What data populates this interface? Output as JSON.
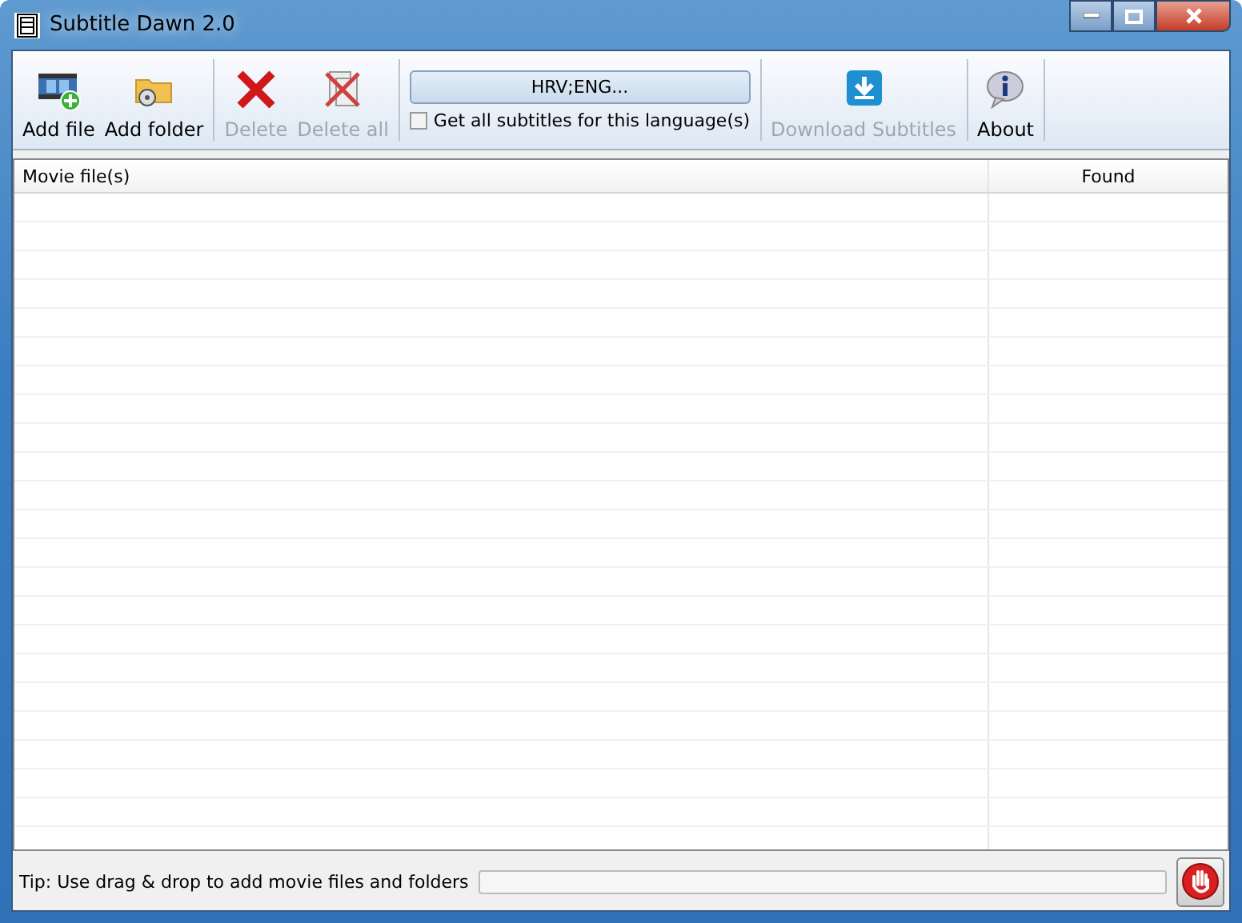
{
  "window": {
    "title": "Subtitle Dawn 2.0"
  },
  "toolbar": {
    "groups": [
      [
        {
          "label": "Add file",
          "disabled": false
        },
        {
          "label": "Add folder",
          "disabled": false
        }
      ],
      [
        {
          "label": "Delete",
          "disabled": true
        },
        {
          "label": "Delete all",
          "disabled": true
        }
      ],
      [
        {
          "kind": "language",
          "label": "HRV;ENG...",
          "checkbox": {
            "label": "Get all subtitles for this language(s)",
            "checked": false
          }
        }
      ],
      [
        {
          "label": "Download Subtitles",
          "disabled": true
        }
      ],
      [
        {
          "label": "About",
          "disabled": false
        }
      ]
    ]
  },
  "table": {
    "columns": [
      "Movie file(s)",
      "Found"
    ]
  },
  "status_bar": {
    "tip": "Tip: Use drag & drop to add movie files and folders",
    "progress": {
      "level": 0
    }
  }
}
